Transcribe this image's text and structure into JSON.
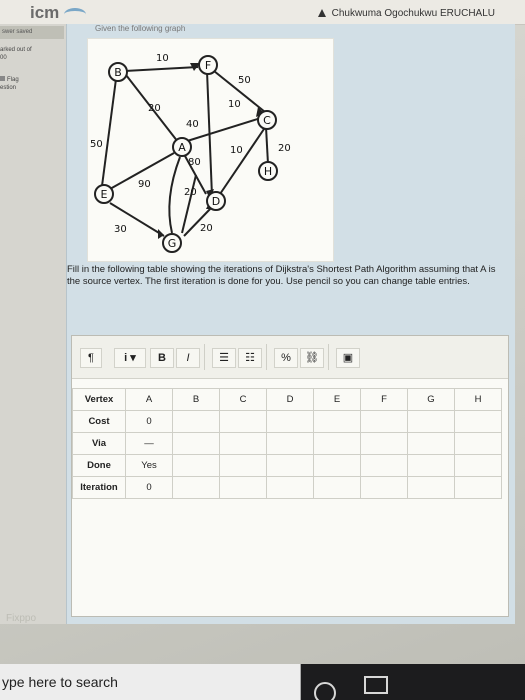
{
  "app": {
    "brand": "icm",
    "user_name": "Chukwuma Ogochukwu ERUCHALU"
  },
  "sidebar": {
    "saved": "swer saved",
    "marked": "arked out of",
    "marked_value": "00",
    "flag": "Flag",
    "question_word": "estion"
  },
  "question": {
    "heading": "Given the following graph",
    "prompt": "Fill in the following table showing the iterations of Dijkstra's Shortest Path Algorithm assuming that A is the source vertex. The first iteration is done for you. Use pencil so you can change table entries."
  },
  "graph": {
    "nodes": [
      "B",
      "F",
      "A",
      "C",
      "H",
      "E",
      "D",
      "G"
    ],
    "edge_labels": [
      "10",
      "50",
      "20",
      "40",
      "10",
      "20",
      "50",
      "10",
      "80",
      "90",
      "20",
      "30",
      "20"
    ]
  },
  "toolbar": {
    "para_label": "¶",
    "info_label": "i ▾",
    "bold_label": "B",
    "italic_label": "I",
    "ul_label": "☰",
    "ol_label": "☷",
    "link_label": "%",
    "unlink_label": "⛓",
    "image_label": "▣"
  },
  "table": {
    "rows": [
      {
        "label": "Vertex",
        "cells": [
          "A",
          "B",
          "C",
          "D",
          "E",
          "F",
          "G",
          "H"
        ]
      },
      {
        "label": "Cost",
        "cells": [
          "0",
          "",
          "",
          "",
          "",
          "",
          "",
          ""
        ]
      },
      {
        "label": "Via",
        "cells": [
          "—",
          "",
          "",
          "",
          "",
          "",
          "",
          ""
        ]
      },
      {
        "label": "Done",
        "cells": [
          "Yes",
          "",
          "",
          "",
          "",
          "",
          "",
          ""
        ]
      },
      {
        "label": "Iteration",
        "cells": [
          "0",
          "",
          "",
          "",
          "",
          "",
          "",
          ""
        ]
      }
    ]
  },
  "footer": {
    "label": "Fixppo"
  },
  "taskbar": {
    "search_placeholder": "ype here to search"
  }
}
